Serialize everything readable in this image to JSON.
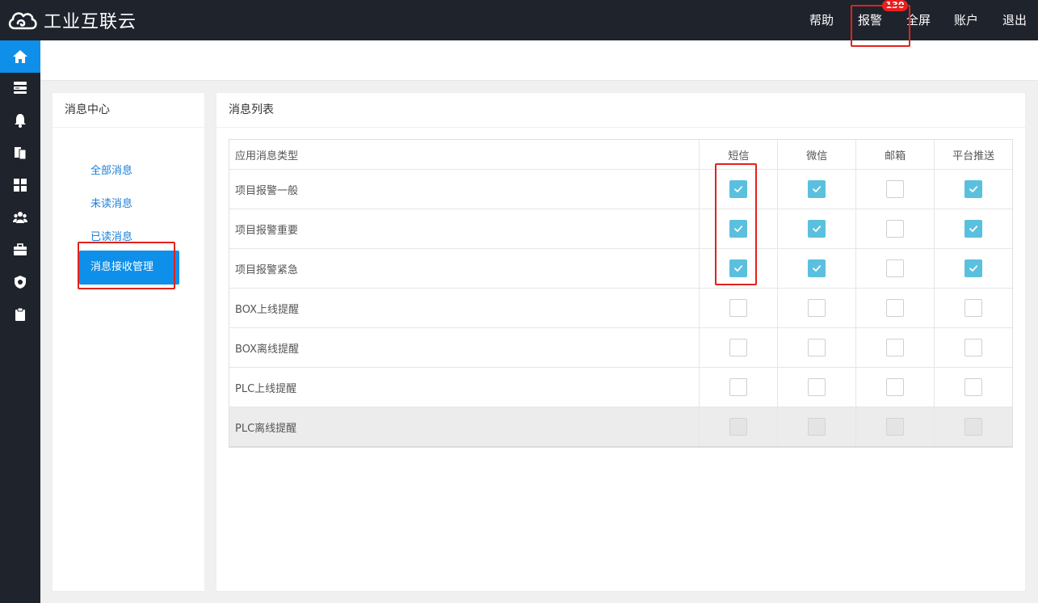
{
  "header": {
    "app_title": "工业互联云",
    "nav": {
      "help": "帮助",
      "alarm": "报警",
      "alarm_badge": "130",
      "fullscreen": "全屏",
      "account": "账户",
      "exit": "退出"
    }
  },
  "sidebar": {
    "icons": [
      "home-icon",
      "server-icon",
      "bell-icon",
      "copy-icon",
      "dashboard-icon",
      "users-icon",
      "briefcase-icon",
      "shield-icon",
      "clipboard-icon"
    ],
    "active_index": 0,
    "active_color": "#0e8fea"
  },
  "message_center": {
    "title": "消息中心",
    "menu": {
      "all": "全部消息",
      "unread": "未读消息",
      "read": "已读消息",
      "receive_manage": "消息接收管理"
    }
  },
  "message_list": {
    "title": "消息列表",
    "columns": [
      "应用消息类型",
      "短信",
      "微信",
      "邮箱",
      "平台推送"
    ],
    "rows": [
      {
        "type": "项目报警一般",
        "checks": [
          true,
          true,
          false,
          true
        ],
        "disabled": false
      },
      {
        "type": "项目报警重要",
        "checks": [
          true,
          true,
          false,
          true
        ],
        "disabled": false
      },
      {
        "type": "项目报警紧急",
        "checks": [
          true,
          true,
          false,
          true
        ],
        "disabled": false
      },
      {
        "type": "BOX上线提醒",
        "checks": [
          false,
          false,
          false,
          false
        ],
        "disabled": false
      },
      {
        "type": "BOX离线提醒",
        "checks": [
          false,
          false,
          false,
          false
        ],
        "disabled": false
      },
      {
        "type": "PLC上线提醒",
        "checks": [
          false,
          false,
          false,
          false
        ],
        "disabled": false
      },
      {
        "type": "PLC离线提醒",
        "checks": [
          false,
          false,
          false,
          false
        ],
        "disabled": true
      }
    ]
  },
  "colors": {
    "topbar": "#1f232c",
    "checkbox_checked": "#5bc0de",
    "highlight_border": "#e0221c",
    "link": "#1a7fd8"
  }
}
